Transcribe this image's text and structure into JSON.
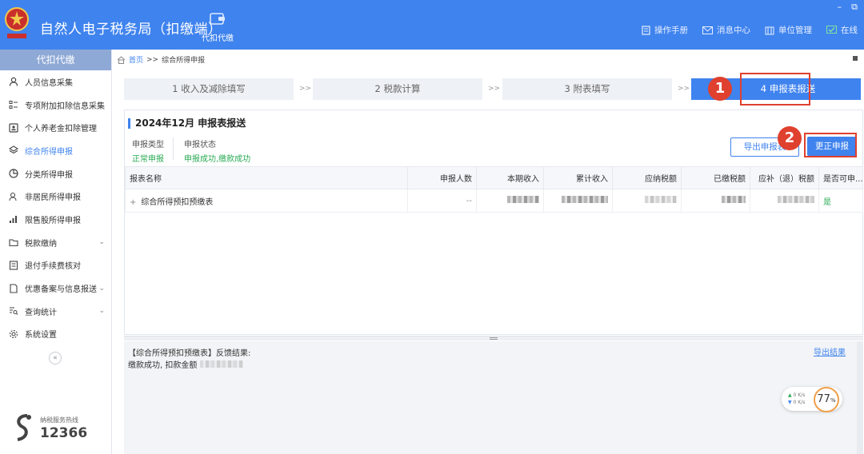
{
  "header": {
    "app_title": "自然人电子税务局（扣缴端）",
    "nav_label": "代扣代缴",
    "links": [
      "操作手册",
      "消息中心",
      "单位管理",
      "在线"
    ],
    "win_min": "–",
    "win_max": "⧉"
  },
  "sidebar": {
    "title": "代扣代缴",
    "items": [
      {
        "label": "人员信息采集",
        "icon": "person-icon"
      },
      {
        "label": "专项附加扣除信息采集",
        "icon": "list-icon"
      },
      {
        "label": "个人养老金扣除管理",
        "icon": "card-icon"
      },
      {
        "label": "综合所得申报",
        "icon": "layers-icon"
      },
      {
        "label": "分类所得申报",
        "icon": "pie-icon"
      },
      {
        "label": "非居民所得申报",
        "icon": "person-outline-icon"
      },
      {
        "label": "限售股所得申报",
        "icon": "bars-icon"
      },
      {
        "label": "税款缴纳",
        "icon": "folder-icon"
      },
      {
        "label": "退付手续费核对",
        "icon": "doc-icon"
      },
      {
        "label": "优惠备案与信息报送",
        "icon": "page-icon"
      },
      {
        "label": "查询统计",
        "icon": "search-list-icon"
      },
      {
        "label": "系统设置",
        "icon": "gear-icon"
      }
    ],
    "active_index": 3,
    "hotline_label": "纳税服务热线",
    "hotline_number": "12366"
  },
  "breadcrumb": {
    "home": "首页",
    "sep": ">>",
    "current": "综合所得申报"
  },
  "steps": [
    {
      "label": "1 收入及减除填写"
    },
    {
      "label": "2 税款计算"
    },
    {
      "label": "3 附表填写"
    },
    {
      "label": "4 申报表报送"
    }
  ],
  "step_sep": ">>",
  "active_step": 3,
  "panel": {
    "title": "2024年12月  申报表报送",
    "declare_type_label": "申报类型",
    "declare_type_value": "正常申报",
    "declare_status_label": "申报状态",
    "declare_status_value": "申报成功,缴款成功",
    "export_button": "导出申报表",
    "correct_button": "更正申报"
  },
  "table": {
    "columns": [
      "报表名称",
      "申报人数",
      "本期收入",
      "累计收入",
      "应纳税额",
      "已缴税额",
      "应补（退）税额",
      "是否可申..."
    ],
    "rows": [
      {
        "name": "综合所得预扣预缴表",
        "count": "--",
        "can_declare": "是"
      }
    ]
  },
  "result": {
    "head": "【综合所得预扣预缴表】反馈结果:",
    "body": "缴款成功, 扣款金额",
    "export_link": "导出结果"
  },
  "speed": {
    "up": "0   K/s",
    "down": "0   K/s",
    "percent": "77",
    "percent_unit": "%"
  },
  "annotations": [
    {
      "number": "1"
    },
    {
      "number": "2"
    }
  ],
  "colors": {
    "primary": "#3f83ee",
    "success": "#2bab55",
    "annotation": "#e0402e"
  }
}
